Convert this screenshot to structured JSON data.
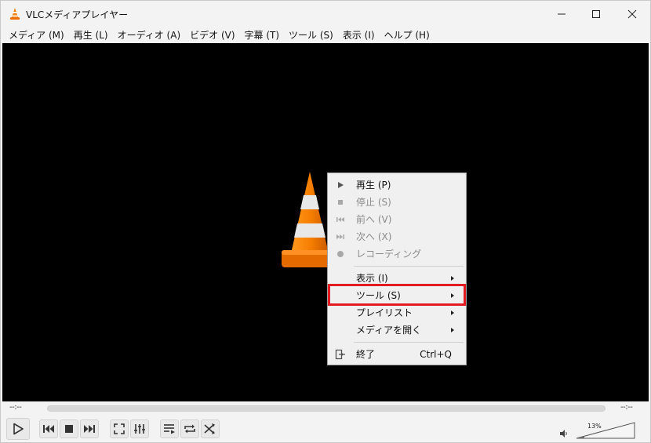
{
  "window": {
    "title": "VLCメディアプレイヤー"
  },
  "menubar": {
    "items": [
      {
        "label": "メディア (M)"
      },
      {
        "label": "再生 (L)"
      },
      {
        "label": "オーディオ (A)"
      },
      {
        "label": "ビデオ (V)"
      },
      {
        "label": "字幕 (T)"
      },
      {
        "label": "ツール (S)"
      },
      {
        "label": "表示 (I)"
      },
      {
        "label": "ヘルプ (H)"
      }
    ]
  },
  "context_menu": {
    "items": [
      {
        "label": "再生 (P)",
        "icon": "play-icon",
        "enabled": true
      },
      {
        "label": "停止 (S)",
        "icon": "stop-icon",
        "enabled": false
      },
      {
        "label": "前へ (V)",
        "icon": "previous-icon",
        "enabled": false
      },
      {
        "label": "次へ (X)",
        "icon": "next-icon",
        "enabled": false
      },
      {
        "label": "レコーディング",
        "icon": "record-icon",
        "enabled": false
      },
      {
        "label": "表示 (I)",
        "submenu": true
      },
      {
        "label": "ツール (S)",
        "submenu": true,
        "highlighted": true
      },
      {
        "label": "プレイリスト",
        "submenu": true
      },
      {
        "label": "メディアを開く",
        "submenu": true
      },
      {
        "label": "終了",
        "icon": "exit-icon",
        "shortcut": "Ctrl+Q"
      }
    ],
    "highlight_color": "#e31b23"
  },
  "seekbar": {
    "elapsed": "--:--",
    "remaining": "--:--"
  },
  "controls": {
    "volume": "13%"
  },
  "colors": {
    "video_background": "#000000",
    "cone_orange": "#f57c00"
  }
}
